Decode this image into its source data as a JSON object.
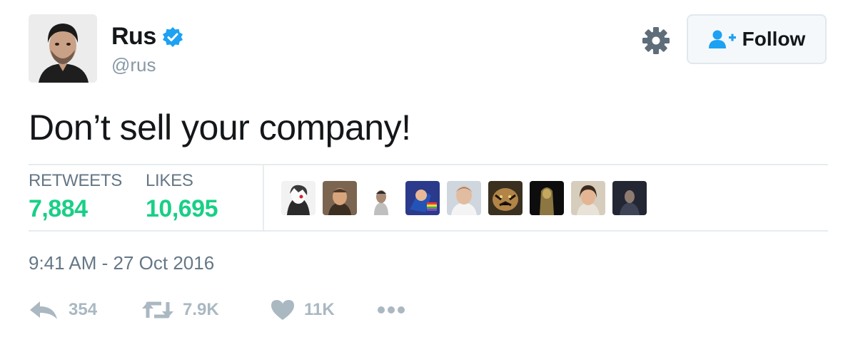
{
  "author": {
    "name": "Rus",
    "handle": "@rus"
  },
  "follow_button": {
    "label": "Follow"
  },
  "tweet": {
    "text": "Don’t sell your company!"
  },
  "stats": {
    "retweets_label": "RETWEETS",
    "retweets_value": "7,884",
    "likes_label": "LIKES",
    "likes_value": "10,695"
  },
  "timestamp": "9:41 AM - 27 Oct 2016",
  "actions": {
    "reply_count": "354",
    "retweet_count": "7.9K",
    "like_count": "11K"
  },
  "colors": {
    "accent": "#1da1f2",
    "stat_green": "#19cf86",
    "muted": "#657786",
    "icon_gray": "#aab8c2"
  }
}
